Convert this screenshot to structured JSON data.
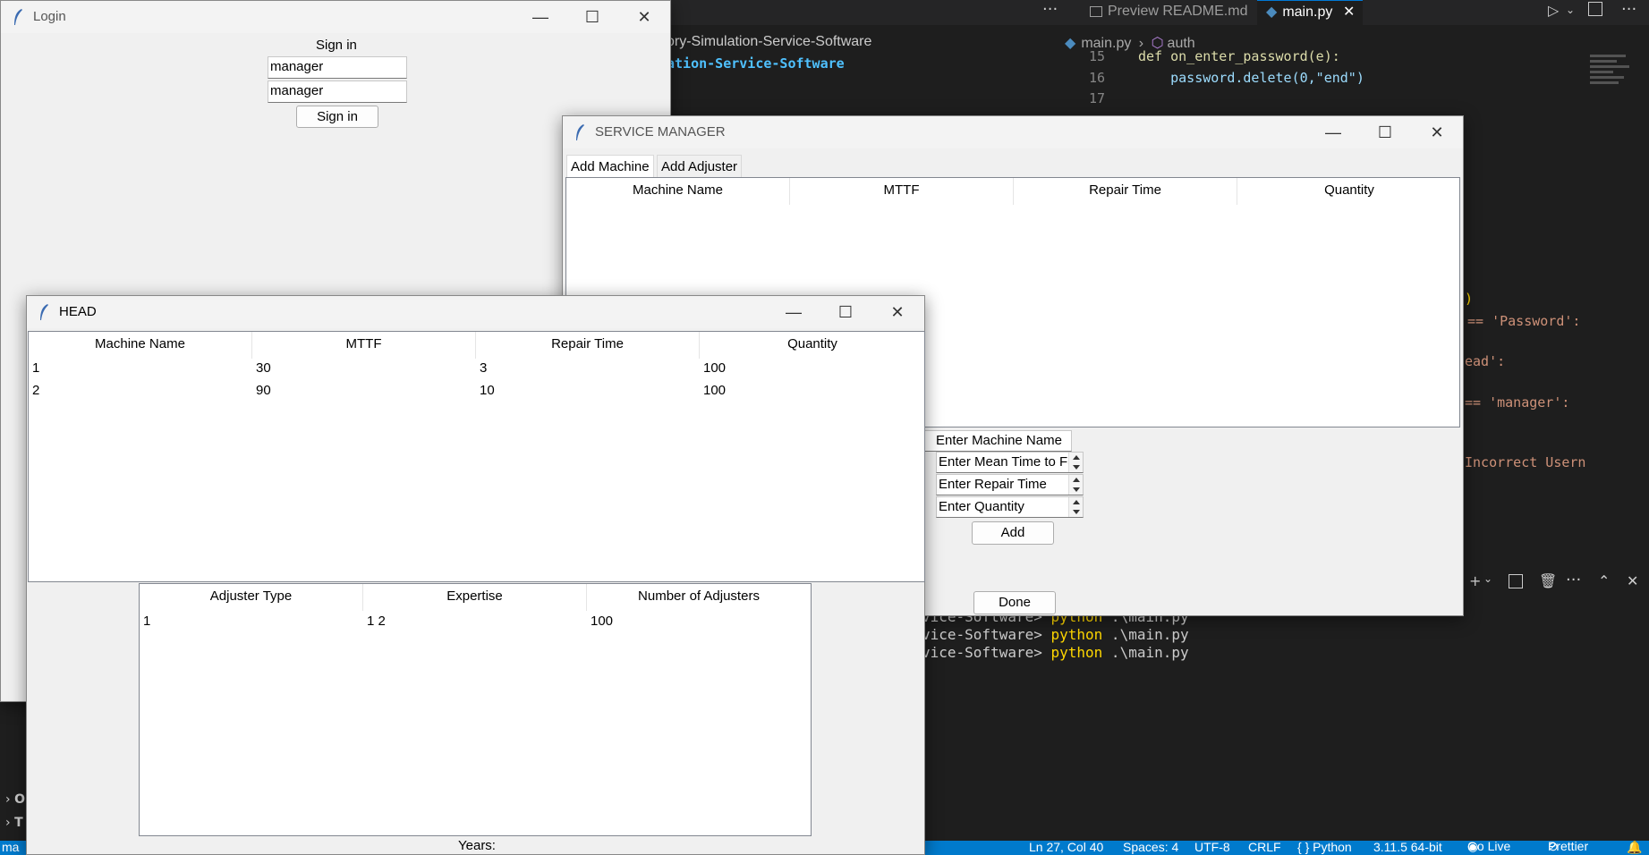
{
  "vscode": {
    "tabs": [
      {
        "label": "Preview README.md",
        "active": false
      },
      {
        "label": "main.py",
        "active": true
      }
    ],
    "breadcrumb": [
      "main.py",
      "auth"
    ],
    "left_path": "ory-Simulation-Service-Software",
    "left_path2": "ation-Service-Software",
    "code": {
      "line15": {
        "num": "15",
        "text": "def on_enter_password(e):"
      },
      "line16": {
        "num": "16",
        "text": "    password.delete(0,\"end\")"
      },
      "line17": {
        "num": "17",
        "text": ""
      },
      "frag_password": "== 'Password':",
      "frag_head": "ead':",
      "frag_manager": "== 'manager':",
      "frag_incorrect": "Incorrect Usern",
      "frag_paren": ")"
    },
    "terminal": [
      {
        "prefix": "vice-Software> ",
        "cmd": "python",
        "arg": " .\\main.py"
      },
      {
        "prefix": "vice-Software> ",
        "cmd": "python",
        "arg": " .\\main.py"
      },
      {
        "prefix": "vice-Software> ",
        "cmd": "python",
        "arg": " .\\main.py"
      }
    ],
    "status": {
      "left": "ma",
      "position": "Ln 27, Col 40",
      "spaces": "Spaces: 4",
      "encoding": "UTF-8",
      "eol": "CRLF",
      "language": "{ } Python",
      "interpreter": "3.11.5 64-bit",
      "golive": "Go Live",
      "prettier": "Prettier"
    },
    "side_collapsed": [
      "O",
      "T"
    ],
    "accent": "#007acc"
  },
  "login": {
    "title": "Login",
    "heading": "Sign in",
    "username": "manager",
    "password": "manager",
    "button": "Sign in"
  },
  "service_manager": {
    "title": "SERVICE MANAGER",
    "tabs": [
      {
        "label": "Add Machine",
        "active": true
      },
      {
        "label": "Add Adjuster",
        "active": false
      }
    ],
    "columns": [
      "Machine Name",
      "MTTF",
      "Repair Time",
      "Quantity"
    ],
    "form": {
      "machine_name": "Enter Machine Name",
      "mttf": "Enter Mean Time to Fai",
      "repair_time": "Enter Repair Time",
      "quantity": "Enter Quantity",
      "add_button": "Add"
    },
    "done_button": "Done"
  },
  "head": {
    "title": "HEAD",
    "machine_columns": [
      "Machine Name",
      "MTTF",
      "Repair Time",
      "Quantity"
    ],
    "machine_rows": [
      [
        "1",
        "30",
        "3",
        "100"
      ],
      [
        "2",
        "90",
        "10",
        "100"
      ]
    ],
    "adjuster_columns": [
      "Adjuster Type",
      "Expertise",
      "Number of Adjusters"
    ],
    "adjuster_rows": [
      [
        "1",
        "1 2",
        "100"
      ]
    ],
    "years_label": "Years:"
  }
}
